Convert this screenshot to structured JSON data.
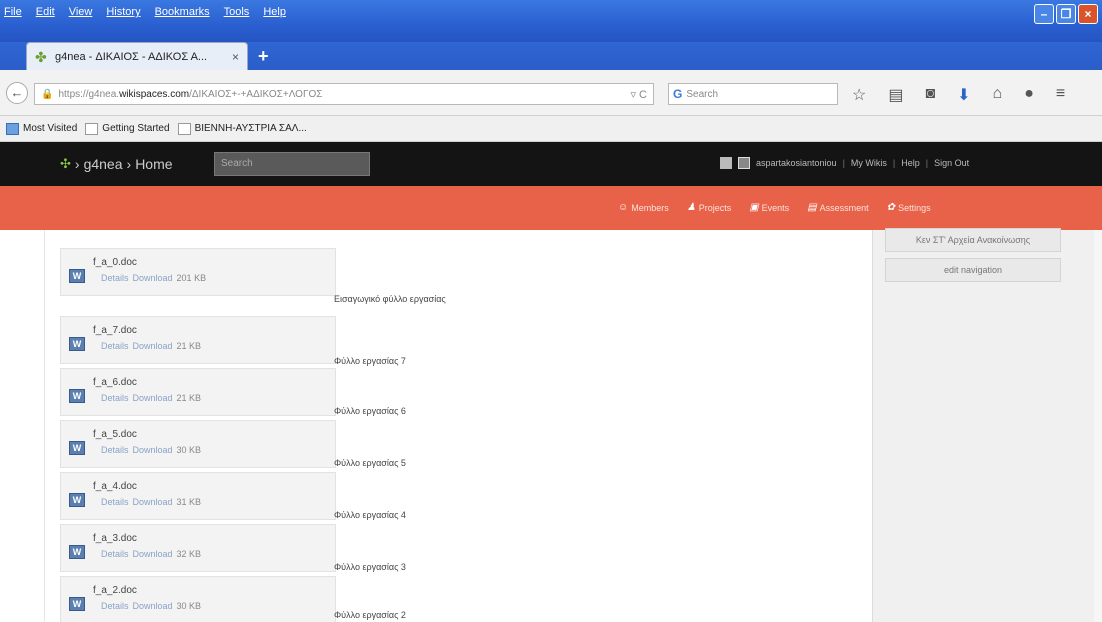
{
  "menu": [
    "File",
    "Edit",
    "View",
    "History",
    "Bookmarks",
    "Tools",
    "Help"
  ],
  "tab": {
    "title": "g4nea - ΔΙΚΑΙΟΣ - ΑΔΙΚΟΣ Α...",
    "close": "×",
    "new": "+"
  },
  "nav": {
    "url_prefix": "https://g4nea.",
    "url_domain": "wikispaces.com",
    "url_path": "/ΔΙΚΑΙΟΣ+-+ΑΔΙΚΟΣ+ΛΟΓΟΣ",
    "search_placeholder": "Search"
  },
  "bookmarks": [
    {
      "label": "Most Visited"
    },
    {
      "label": "Getting Started"
    },
    {
      "label": "ΒΙΕΝΝΗ-ΑΥΣΤΡΙΑ ΣΑΛ..."
    }
  ],
  "site": {
    "logo_text": "g4nea",
    "crumb_sep": "›",
    "crumb_home": "Home",
    "search_placeholder": "Search",
    "username": "aspartakosiantoniou",
    "links": [
      "My Wikis",
      "Help",
      "Sign Out"
    ]
  },
  "orange_nav": [
    "Members",
    "Projects",
    "Events",
    "Assessment",
    "Settings"
  ],
  "sidebar": [
    "Κεν ΣΤ' Αρχεία Ανακοίνωσης",
    "edit navigation"
  ],
  "files": [
    {
      "name": "f_a_0.doc",
      "details": "Details",
      "download": "Download",
      "size": "201 KB",
      "description": "Εισαγωγικό φύλλο εργασίας"
    },
    {
      "name": "f_a_7.doc",
      "details": "Details",
      "download": "Download",
      "size": "21 KB",
      "description": "Φύλλο εργασίας 7"
    },
    {
      "name": "f_a_6.doc",
      "details": "Details",
      "download": "Download",
      "size": "21 KB",
      "description": "Φύλλο εργασίας 6"
    },
    {
      "name": "f_a_5.doc",
      "details": "Details",
      "download": "Download",
      "size": "30 KB",
      "description": "Φύλλο εργασίας 5"
    },
    {
      "name": "f_a_4.doc",
      "details": "Details",
      "download": "Download",
      "size": "31 KB",
      "description": "Φύλλο εργασίας 4"
    },
    {
      "name": "f_a_3.doc",
      "details": "Details",
      "download": "Download",
      "size": "32 KB",
      "description": "Φύλλο εργασίας 3"
    },
    {
      "name": "f_a_2.doc",
      "details": "Details",
      "download": "Download",
      "size": "30 KB",
      "description": "Φύλλο εργασίας 2"
    }
  ]
}
